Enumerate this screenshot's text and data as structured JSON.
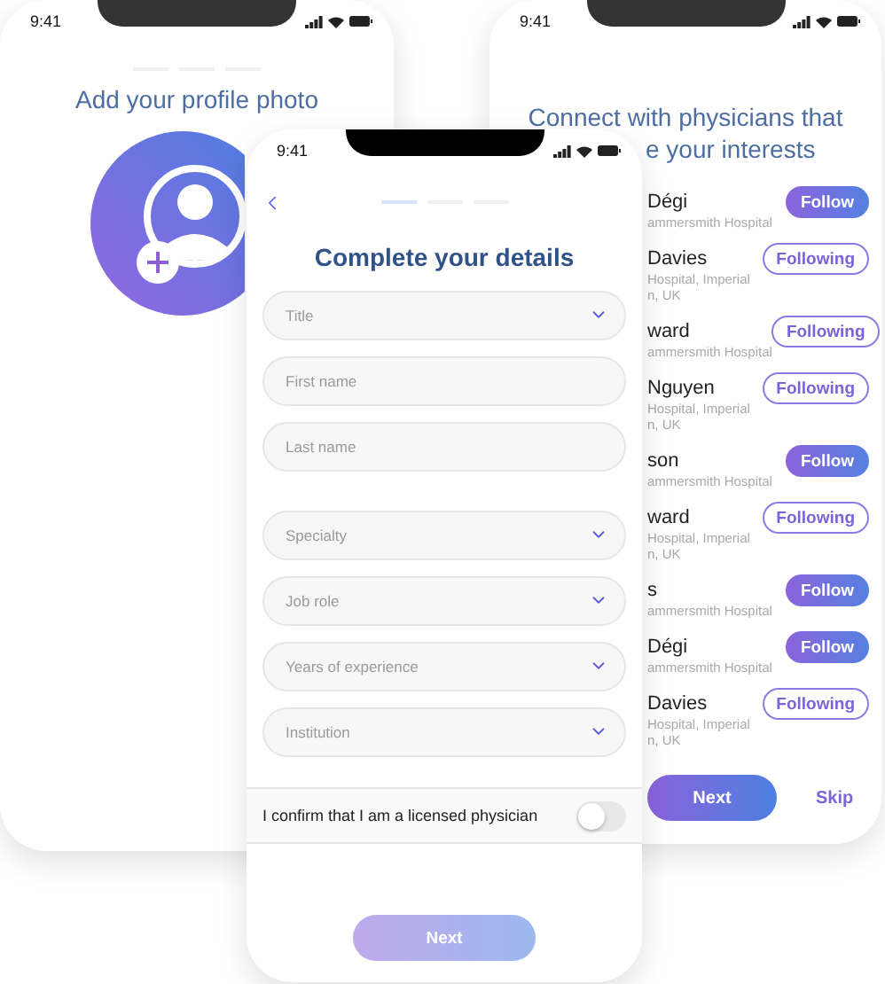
{
  "profile_screen": {
    "time": "9:41",
    "steps": [
      {
        "selected": false
      },
      {
        "selected": false
      },
      {
        "selected": false
      }
    ],
    "title": "Add your profile photo"
  },
  "physicians_screen": {
    "time": "9:41",
    "title_lines": [
      "Connect with physicians that",
      "e your interests"
    ],
    "physicians": [
      {
        "name": "Dégi",
        "detail_lines": [
          "ammersmith Hospital"
        ],
        "following": false,
        "button": "Follow"
      },
      {
        "name": "Davies",
        "detail_lines": [
          "Hospital, Imperial",
          "n, UK"
        ],
        "following": true,
        "button": "Following"
      },
      {
        "name": "ward",
        "detail_lines": [
          "ammersmith Hospital"
        ],
        "following": true,
        "button": "Following"
      },
      {
        "name": "Nguyen",
        "detail_lines": [
          "Hospital, Imperial",
          "n, UK"
        ],
        "following": true,
        "button": "Following"
      },
      {
        "name": "son",
        "detail_lines": [
          "ammersmith Hospital"
        ],
        "following": false,
        "button": "Follow"
      },
      {
        "name": "ward",
        "detail_lines": [
          "Hospital, Imperial",
          "n, UK"
        ],
        "following": true,
        "button": "Following"
      },
      {
        "name": "s",
        "detail_lines": [
          "ammersmith Hospital"
        ],
        "following": false,
        "button": "Follow"
      },
      {
        "name": "Dégi",
        "detail_lines": [
          "ammersmith Hospital"
        ],
        "following": false,
        "button": "Follow"
      },
      {
        "name": "Davies",
        "detail_lines": [
          "Hospital, Imperial",
          "n, UK"
        ],
        "following": true,
        "button": "Following"
      }
    ],
    "next_button": "Next",
    "skip_button": "Skip"
  },
  "details_screen": {
    "time": "9:41",
    "steps": [
      {
        "selected": true
      },
      {
        "selected": false
      },
      {
        "selected": false
      }
    ],
    "title": "Complete your details",
    "field_groups": [
      [
        {
          "kind": "select",
          "placeholder": "Title"
        },
        {
          "kind": "text",
          "placeholder": "First name"
        },
        {
          "kind": "text",
          "placeholder": "Last name"
        }
      ],
      [
        {
          "kind": "select",
          "placeholder": "Specialty"
        },
        {
          "kind": "select",
          "placeholder": "Job role"
        },
        {
          "kind": "select",
          "placeholder": "Years of experience"
        },
        {
          "kind": "select",
          "placeholder": "Institution"
        }
      ]
    ],
    "confirm": {
      "label": "I confirm that I am a licensed physician",
      "on": false
    },
    "next_button": {
      "label": "Next",
      "disabled": true
    }
  }
}
